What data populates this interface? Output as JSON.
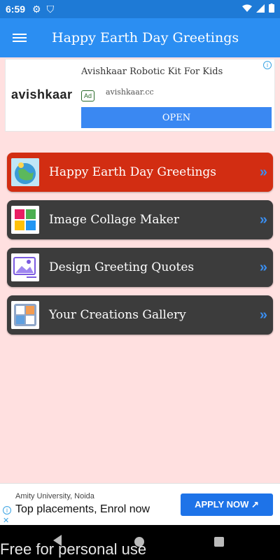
{
  "status_bar": {
    "time": "6:59"
  },
  "app_bar": {
    "title": "Happy Earth Day Greetings"
  },
  "top_ad": {
    "logo": "avishkaar",
    "headline": "Avishkaar Robotic Kit For Kids",
    "badge": "Ad",
    "url": "avishkaar.cc",
    "button": "OPEN"
  },
  "menu": {
    "items": [
      {
        "label": "Happy Earth Day Greetings",
        "arrow": "»",
        "active": true
      },
      {
        "label": "Image Collage Maker",
        "arrow": "»"
      },
      {
        "label": "Design Greeting Quotes",
        "arrow": "»"
      },
      {
        "label": "Your Creations Gallery",
        "arrow": "»"
      }
    ]
  },
  "bottom_ad": {
    "sub": "Amity University, Noida",
    "main": "Top placements, Enrol now",
    "button": "APPLY NOW"
  },
  "watermark": "Free for personal use",
  "colors": {
    "primary": "#2b8ef2",
    "active_item": "#d22d12",
    "item_bg": "#3c3c3c",
    "background": "#ffe0e0"
  }
}
